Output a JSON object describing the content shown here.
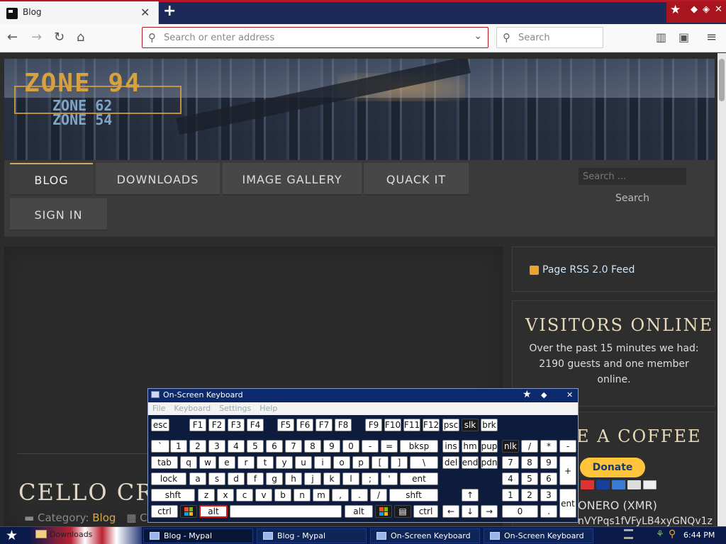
{
  "browser": {
    "tab_title": "Blog",
    "tab_close": "✕",
    "new_tab": "+",
    "url_placeholder": "Search or enter address",
    "search_placeholder": "Search"
  },
  "site": {
    "logo_main": "ZONE 94",
    "logo_sub1": "ZONE 62",
    "logo_sub2": "ZONE 54",
    "nav": [
      "BLOG",
      "DOWNLOADS",
      "IMAGE GALLERY",
      "QUACK IT",
      "SIGN IN"
    ],
    "search_placeholder": "Search ...",
    "search_button": "Search",
    "post_title": "CELLO CROSS",
    "post_category_label": "Category:",
    "post_category": "Blog",
    "post_more": "Cu"
  },
  "sidebar": {
    "rss": "Page RSS 2.0 Feed",
    "visitors_title": "VISITORS ONLINE",
    "visitors_text": "Over the past 15 minutes we had: 2190 guests and one member online.",
    "coffee_title": "E A COFFEE",
    "donate": "Donate",
    "monero": "ONERO (XMR)",
    "wallet": "nVYPqs1fVFyLB4xyGNQv1z"
  },
  "osk": {
    "title": "On-Screen Keyboard",
    "menu": [
      "File",
      "Keyboard",
      "Settings",
      "Help"
    ]
  },
  "taskbar": {
    "start_label": "Downloads",
    "buttons": [
      "Blog - Mypal",
      "Blog - Mypal",
      "On-Screen Keyboard",
      "On-Screen Keyboard"
    ],
    "clock": "6:44 PM"
  },
  "colors": {
    "accent_gold": "#d6a13e",
    "tab_bar": "#1c2a5a",
    "url_border": "#b9151e",
    "paypal_yellow": "#ffc439"
  }
}
